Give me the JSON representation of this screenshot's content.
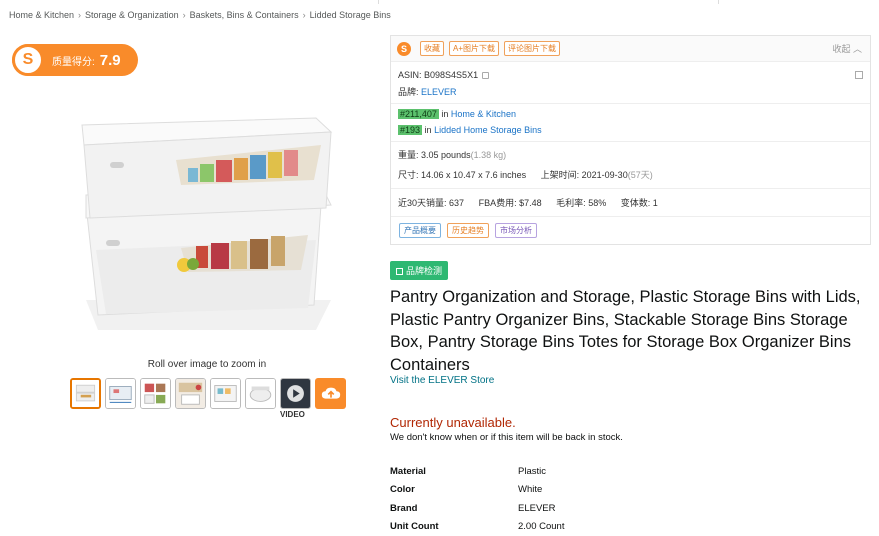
{
  "breadcrumb": [
    "Home & Kitchen",
    "Storage & Organization",
    "Baskets, Bins & Containers",
    "Lidded Storage Bins"
  ],
  "breadcrumb_sep": "›",
  "score": {
    "logo": "S",
    "label": "质量得分:",
    "value": "7.9"
  },
  "gallery": {
    "zoom_hint": "Roll over image to zoom in",
    "video_label": "VIDEO",
    "thumbnails": [
      "box-stack",
      "dimensions",
      "pantry-shelf",
      "kitchen",
      "bins-open",
      "lid-detail",
      "video",
      "upload-icon"
    ]
  },
  "panel": {
    "logo": "S",
    "buttons": [
      "收藏",
      "A+图片下载",
      "评论图片下载"
    ],
    "collapse": "收起 ︿",
    "asin_label": "ASIN:",
    "asin": "B098S4S5X1",
    "brand_label": "品牌:",
    "brand": "ELEVER",
    "ranks": [
      {
        "rank": "#211,407",
        "in": "in",
        "category": "Home & Kitchen"
      },
      {
        "rank": "#193",
        "in": "in",
        "category": "Lidded Home Storage Bins"
      }
    ],
    "weight_label": "重量:",
    "weight": "3.05 pounds",
    "weight_kg": "(1.38 kg)",
    "size_label": "尺寸:",
    "size": "14.06 x 10.47 x 7.6 inches",
    "listed_label": "上架时间:",
    "listed": "2021-09-30",
    "listed_days": "(57天)",
    "sales_label": "近30天销量:",
    "sales": "637",
    "fba_label": "FBA费用:",
    "fba": "$7.48",
    "margin_label": "毛利率:",
    "margin": "58%",
    "variants_label": "变体数:",
    "variants": "1",
    "bottom_tags": [
      "产品概要",
      "历史趋势",
      "市场分析"
    ]
  },
  "brand_check": "品牌检测",
  "title": "Pantry Organization and Storage, Plastic Storage Bins with Lids, Plastic Pantry Organizer Bins, Stackable Storage Bins Storage Box, Pantry Storage Bins Totes for Storage Box Organizer Bins Containers",
  "store_link": "Visit the ELEVER Store",
  "availability": {
    "status": "Currently unavailable.",
    "note": "We don't know when or if this item will be back in stock."
  },
  "attributes": [
    {
      "key": "Material",
      "value": "Plastic"
    },
    {
      "key": "Color",
      "value": "White"
    },
    {
      "key": "Brand",
      "value": "ELEVER"
    },
    {
      "key": "Unit Count",
      "value": "2.00 Count"
    }
  ],
  "colors": {
    "accent": "#f98b2a",
    "link": "#1a73c7",
    "unavailable": "#b12704",
    "rank_bg": "#5cc16d",
    "brand_check": "#2eb872"
  }
}
